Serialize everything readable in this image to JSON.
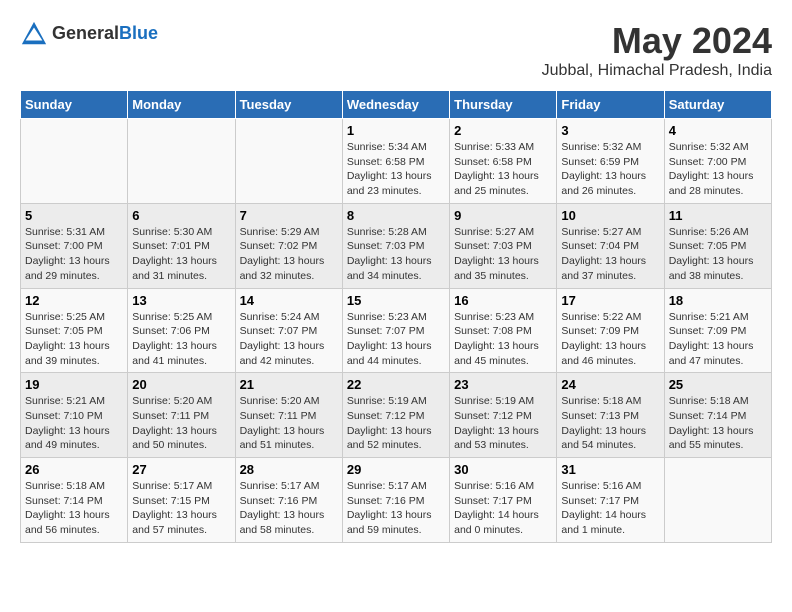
{
  "header": {
    "logo_general": "General",
    "logo_blue": "Blue",
    "month": "May 2024",
    "location": "Jubbal, Himachal Pradesh, India"
  },
  "days_of_week": [
    "Sunday",
    "Monday",
    "Tuesday",
    "Wednesday",
    "Thursday",
    "Friday",
    "Saturday"
  ],
  "weeks": [
    {
      "cells": [
        {
          "day": "",
          "info": ""
        },
        {
          "day": "",
          "info": ""
        },
        {
          "day": "",
          "info": ""
        },
        {
          "day": "1",
          "info": "Sunrise: 5:34 AM\nSunset: 6:58 PM\nDaylight: 13 hours\nand 23 minutes."
        },
        {
          "day": "2",
          "info": "Sunrise: 5:33 AM\nSunset: 6:58 PM\nDaylight: 13 hours\nand 25 minutes."
        },
        {
          "day": "3",
          "info": "Sunrise: 5:32 AM\nSunset: 6:59 PM\nDaylight: 13 hours\nand 26 minutes."
        },
        {
          "day": "4",
          "info": "Sunrise: 5:32 AM\nSunset: 7:00 PM\nDaylight: 13 hours\nand 28 minutes."
        }
      ]
    },
    {
      "cells": [
        {
          "day": "5",
          "info": "Sunrise: 5:31 AM\nSunset: 7:00 PM\nDaylight: 13 hours\nand 29 minutes."
        },
        {
          "day": "6",
          "info": "Sunrise: 5:30 AM\nSunset: 7:01 PM\nDaylight: 13 hours\nand 31 minutes."
        },
        {
          "day": "7",
          "info": "Sunrise: 5:29 AM\nSunset: 7:02 PM\nDaylight: 13 hours\nand 32 minutes."
        },
        {
          "day": "8",
          "info": "Sunrise: 5:28 AM\nSunset: 7:03 PM\nDaylight: 13 hours\nand 34 minutes."
        },
        {
          "day": "9",
          "info": "Sunrise: 5:27 AM\nSunset: 7:03 PM\nDaylight: 13 hours\nand 35 minutes."
        },
        {
          "day": "10",
          "info": "Sunrise: 5:27 AM\nSunset: 7:04 PM\nDaylight: 13 hours\nand 37 minutes."
        },
        {
          "day": "11",
          "info": "Sunrise: 5:26 AM\nSunset: 7:05 PM\nDaylight: 13 hours\nand 38 minutes."
        }
      ]
    },
    {
      "cells": [
        {
          "day": "12",
          "info": "Sunrise: 5:25 AM\nSunset: 7:05 PM\nDaylight: 13 hours\nand 39 minutes."
        },
        {
          "day": "13",
          "info": "Sunrise: 5:25 AM\nSunset: 7:06 PM\nDaylight: 13 hours\nand 41 minutes."
        },
        {
          "day": "14",
          "info": "Sunrise: 5:24 AM\nSunset: 7:07 PM\nDaylight: 13 hours\nand 42 minutes."
        },
        {
          "day": "15",
          "info": "Sunrise: 5:23 AM\nSunset: 7:07 PM\nDaylight: 13 hours\nand 44 minutes."
        },
        {
          "day": "16",
          "info": "Sunrise: 5:23 AM\nSunset: 7:08 PM\nDaylight: 13 hours\nand 45 minutes."
        },
        {
          "day": "17",
          "info": "Sunrise: 5:22 AM\nSunset: 7:09 PM\nDaylight: 13 hours\nand 46 minutes."
        },
        {
          "day": "18",
          "info": "Sunrise: 5:21 AM\nSunset: 7:09 PM\nDaylight: 13 hours\nand 47 minutes."
        }
      ]
    },
    {
      "cells": [
        {
          "day": "19",
          "info": "Sunrise: 5:21 AM\nSunset: 7:10 PM\nDaylight: 13 hours\nand 49 minutes."
        },
        {
          "day": "20",
          "info": "Sunrise: 5:20 AM\nSunset: 7:11 PM\nDaylight: 13 hours\nand 50 minutes."
        },
        {
          "day": "21",
          "info": "Sunrise: 5:20 AM\nSunset: 7:11 PM\nDaylight: 13 hours\nand 51 minutes."
        },
        {
          "day": "22",
          "info": "Sunrise: 5:19 AM\nSunset: 7:12 PM\nDaylight: 13 hours\nand 52 minutes."
        },
        {
          "day": "23",
          "info": "Sunrise: 5:19 AM\nSunset: 7:12 PM\nDaylight: 13 hours\nand 53 minutes."
        },
        {
          "day": "24",
          "info": "Sunrise: 5:18 AM\nSunset: 7:13 PM\nDaylight: 13 hours\nand 54 minutes."
        },
        {
          "day": "25",
          "info": "Sunrise: 5:18 AM\nSunset: 7:14 PM\nDaylight: 13 hours\nand 55 minutes."
        }
      ]
    },
    {
      "cells": [
        {
          "day": "26",
          "info": "Sunrise: 5:18 AM\nSunset: 7:14 PM\nDaylight: 13 hours\nand 56 minutes."
        },
        {
          "day": "27",
          "info": "Sunrise: 5:17 AM\nSunset: 7:15 PM\nDaylight: 13 hours\nand 57 minutes."
        },
        {
          "day": "28",
          "info": "Sunrise: 5:17 AM\nSunset: 7:16 PM\nDaylight: 13 hours\nand 58 minutes."
        },
        {
          "day": "29",
          "info": "Sunrise: 5:17 AM\nSunset: 7:16 PM\nDaylight: 13 hours\nand 59 minutes."
        },
        {
          "day": "30",
          "info": "Sunrise: 5:16 AM\nSunset: 7:17 PM\nDaylight: 14 hours\nand 0 minutes."
        },
        {
          "day": "31",
          "info": "Sunrise: 5:16 AM\nSunset: 7:17 PM\nDaylight: 14 hours\nand 1 minute."
        },
        {
          "day": "",
          "info": ""
        }
      ]
    }
  ]
}
